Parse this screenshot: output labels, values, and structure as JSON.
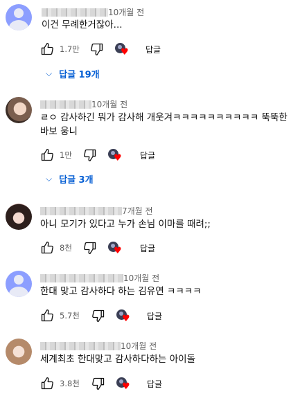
{
  "comments": [
    {
      "time": "10개월 전",
      "text": "이건 무례한거잖아...",
      "likes": "1.7만",
      "reply_label": "답글",
      "replies_label": "답글 19개",
      "avatar": "default-avatar"
    },
    {
      "time": "10개월 전",
      "text": "ㄹㅇ 감사하긴 뭐가 감사해 개웃겨ㅋㅋㅋㅋㅋㅋㅋㅋㅋㅋ 뚝뚝한 바보 웅니",
      "likes": "1만",
      "reply_label": "답글",
      "replies_label": "답글 3개",
      "avatar": "profile-photo"
    },
    {
      "time": "7개월 전",
      "text": "아니 모기가 있다고 누가 손님 이마를 때려;;",
      "likes": "8천",
      "reply_label": "답글",
      "avatar": "profile-photo"
    },
    {
      "time": "10개월 전",
      "text": "한대 맞고 감사하다 하는 김유연 ㅋㅋㅋㅋ",
      "likes": "5.7천",
      "reply_label": "답글",
      "avatar": "default-avatar"
    },
    {
      "time": "10개월 전",
      "text": "세계최초 한대맞고 감사하다하는 아이돌",
      "likes": "3.8천",
      "reply_label": "답글",
      "avatar": "profile-photo"
    }
  ],
  "icons": {
    "like": "thumbs-up-icon",
    "dislike": "thumbs-down-icon",
    "creator_heart": "creator-heart-icon",
    "expand": "chevron-down-icon"
  },
  "colors": {
    "link": "#065fd4",
    "heart": "#ff0000",
    "meta": "#606060"
  }
}
